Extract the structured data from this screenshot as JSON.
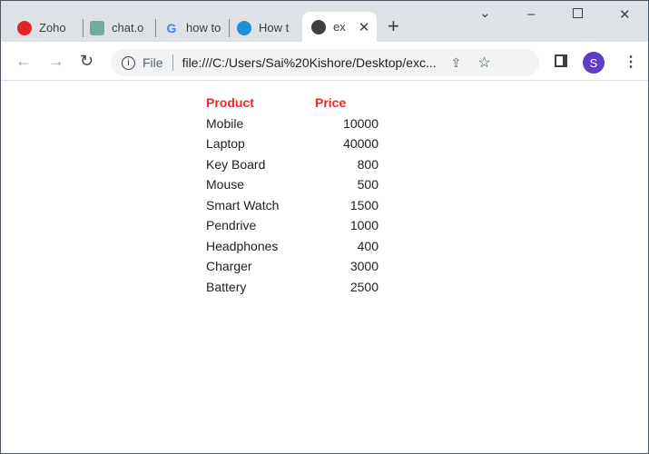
{
  "tabs": [
    {
      "label": "Zoho",
      "icon": "zoho-icon"
    },
    {
      "label": "chat.o",
      "icon": "chatgpt-icon"
    },
    {
      "label": "how to",
      "icon": "google-icon"
    },
    {
      "label": "How t",
      "icon": "edge-icon"
    },
    {
      "label": "ex",
      "icon": "globe-icon",
      "active": true
    }
  ],
  "address": {
    "scheme_label": "File",
    "url": "file:///C:/Users/Sai%20Kishore/Desktop/exc..."
  },
  "profile": {
    "initial": "S"
  },
  "table": {
    "headers": [
      "Product",
      "Price"
    ],
    "rows": [
      [
        "Mobile",
        "10000"
      ],
      [
        "Laptop",
        "40000"
      ],
      [
        "Key Board",
        "800"
      ],
      [
        "Mouse",
        "500"
      ],
      [
        "Smart Watch",
        "1500"
      ],
      [
        "Pendrive",
        "1000"
      ],
      [
        "Headphones",
        "400"
      ],
      [
        "Charger",
        "3000"
      ],
      [
        "Battery",
        "2500"
      ]
    ]
  }
}
